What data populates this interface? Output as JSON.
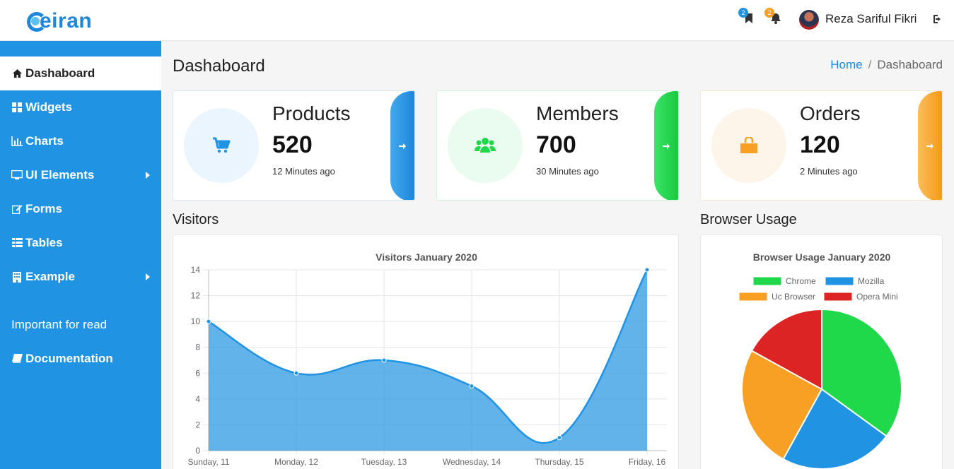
{
  "app": {
    "logo_text": "eiran"
  },
  "header": {
    "bookmarks_count": "2",
    "notifications_count": "2",
    "user_name": "Reza Sariful Fikri",
    "icons": {
      "bookmark": "bookmark-icon",
      "bell": "bell-icon",
      "logout": "sign-out-icon"
    }
  },
  "sidebar": {
    "items": [
      {
        "label": "Dashaboard",
        "icon": "home-icon"
      },
      {
        "label": "Widgets",
        "icon": "grid-icon"
      },
      {
        "label": "Charts",
        "icon": "bar-chart-icon"
      },
      {
        "label": "UI Elements",
        "icon": "desktop-icon"
      },
      {
        "label": "Forms",
        "icon": "edit-icon"
      },
      {
        "label": "Tables",
        "icon": "table-icon"
      },
      {
        "label": "Example",
        "icon": "building-icon"
      }
    ],
    "important_label": "Important for read",
    "documentation_label": "Documentation"
  },
  "page": {
    "title": "Dashaboard"
  },
  "breadcrumb": {
    "home": "Home",
    "separator": "/",
    "current": "Dashaboard"
  },
  "cards": [
    {
      "title": "Products",
      "value": "520",
      "time": "12 Minutes ago",
      "color": "#2193e3",
      "icon": "cart-icon"
    },
    {
      "title": "Members",
      "value": "700",
      "time": "30 Minutes ago",
      "color": "#1fd94a",
      "icon": "users-icon"
    },
    {
      "title": "Orders",
      "value": "120",
      "time": "2 Minutes ago",
      "color": "#f7a023",
      "icon": "shopping-bag-icon"
    }
  ],
  "sections": {
    "visitors": "Visitors",
    "browser": "Browser Usage"
  },
  "chart_data": [
    {
      "type": "area",
      "title": "Visitors January 2020",
      "categories": [
        "Sunday, 11",
        "Monday, 12",
        "Tuesday, 13",
        "Wednesday, 14",
        "Thursday, 15",
        "Friday, 16"
      ],
      "values": [
        10,
        6,
        7,
        5,
        1,
        14
      ],
      "ylim": [
        0,
        14
      ],
      "yticks": [
        "0",
        "2",
        "4",
        "6",
        "8",
        "10",
        "12",
        "14"
      ],
      "grid": true,
      "color": "#2193e3"
    },
    {
      "type": "pie",
      "title": "Browser Usage January 2020",
      "labels": [
        "Chrome",
        "Mozilla",
        "Uc Browser",
        "Opera Mini"
      ],
      "values": [
        35,
        23,
        25,
        17
      ],
      "colors": [
        "#1fd94a",
        "#2193e3",
        "#f7a023",
        "#dd2424"
      ],
      "legend": "top"
    }
  ]
}
